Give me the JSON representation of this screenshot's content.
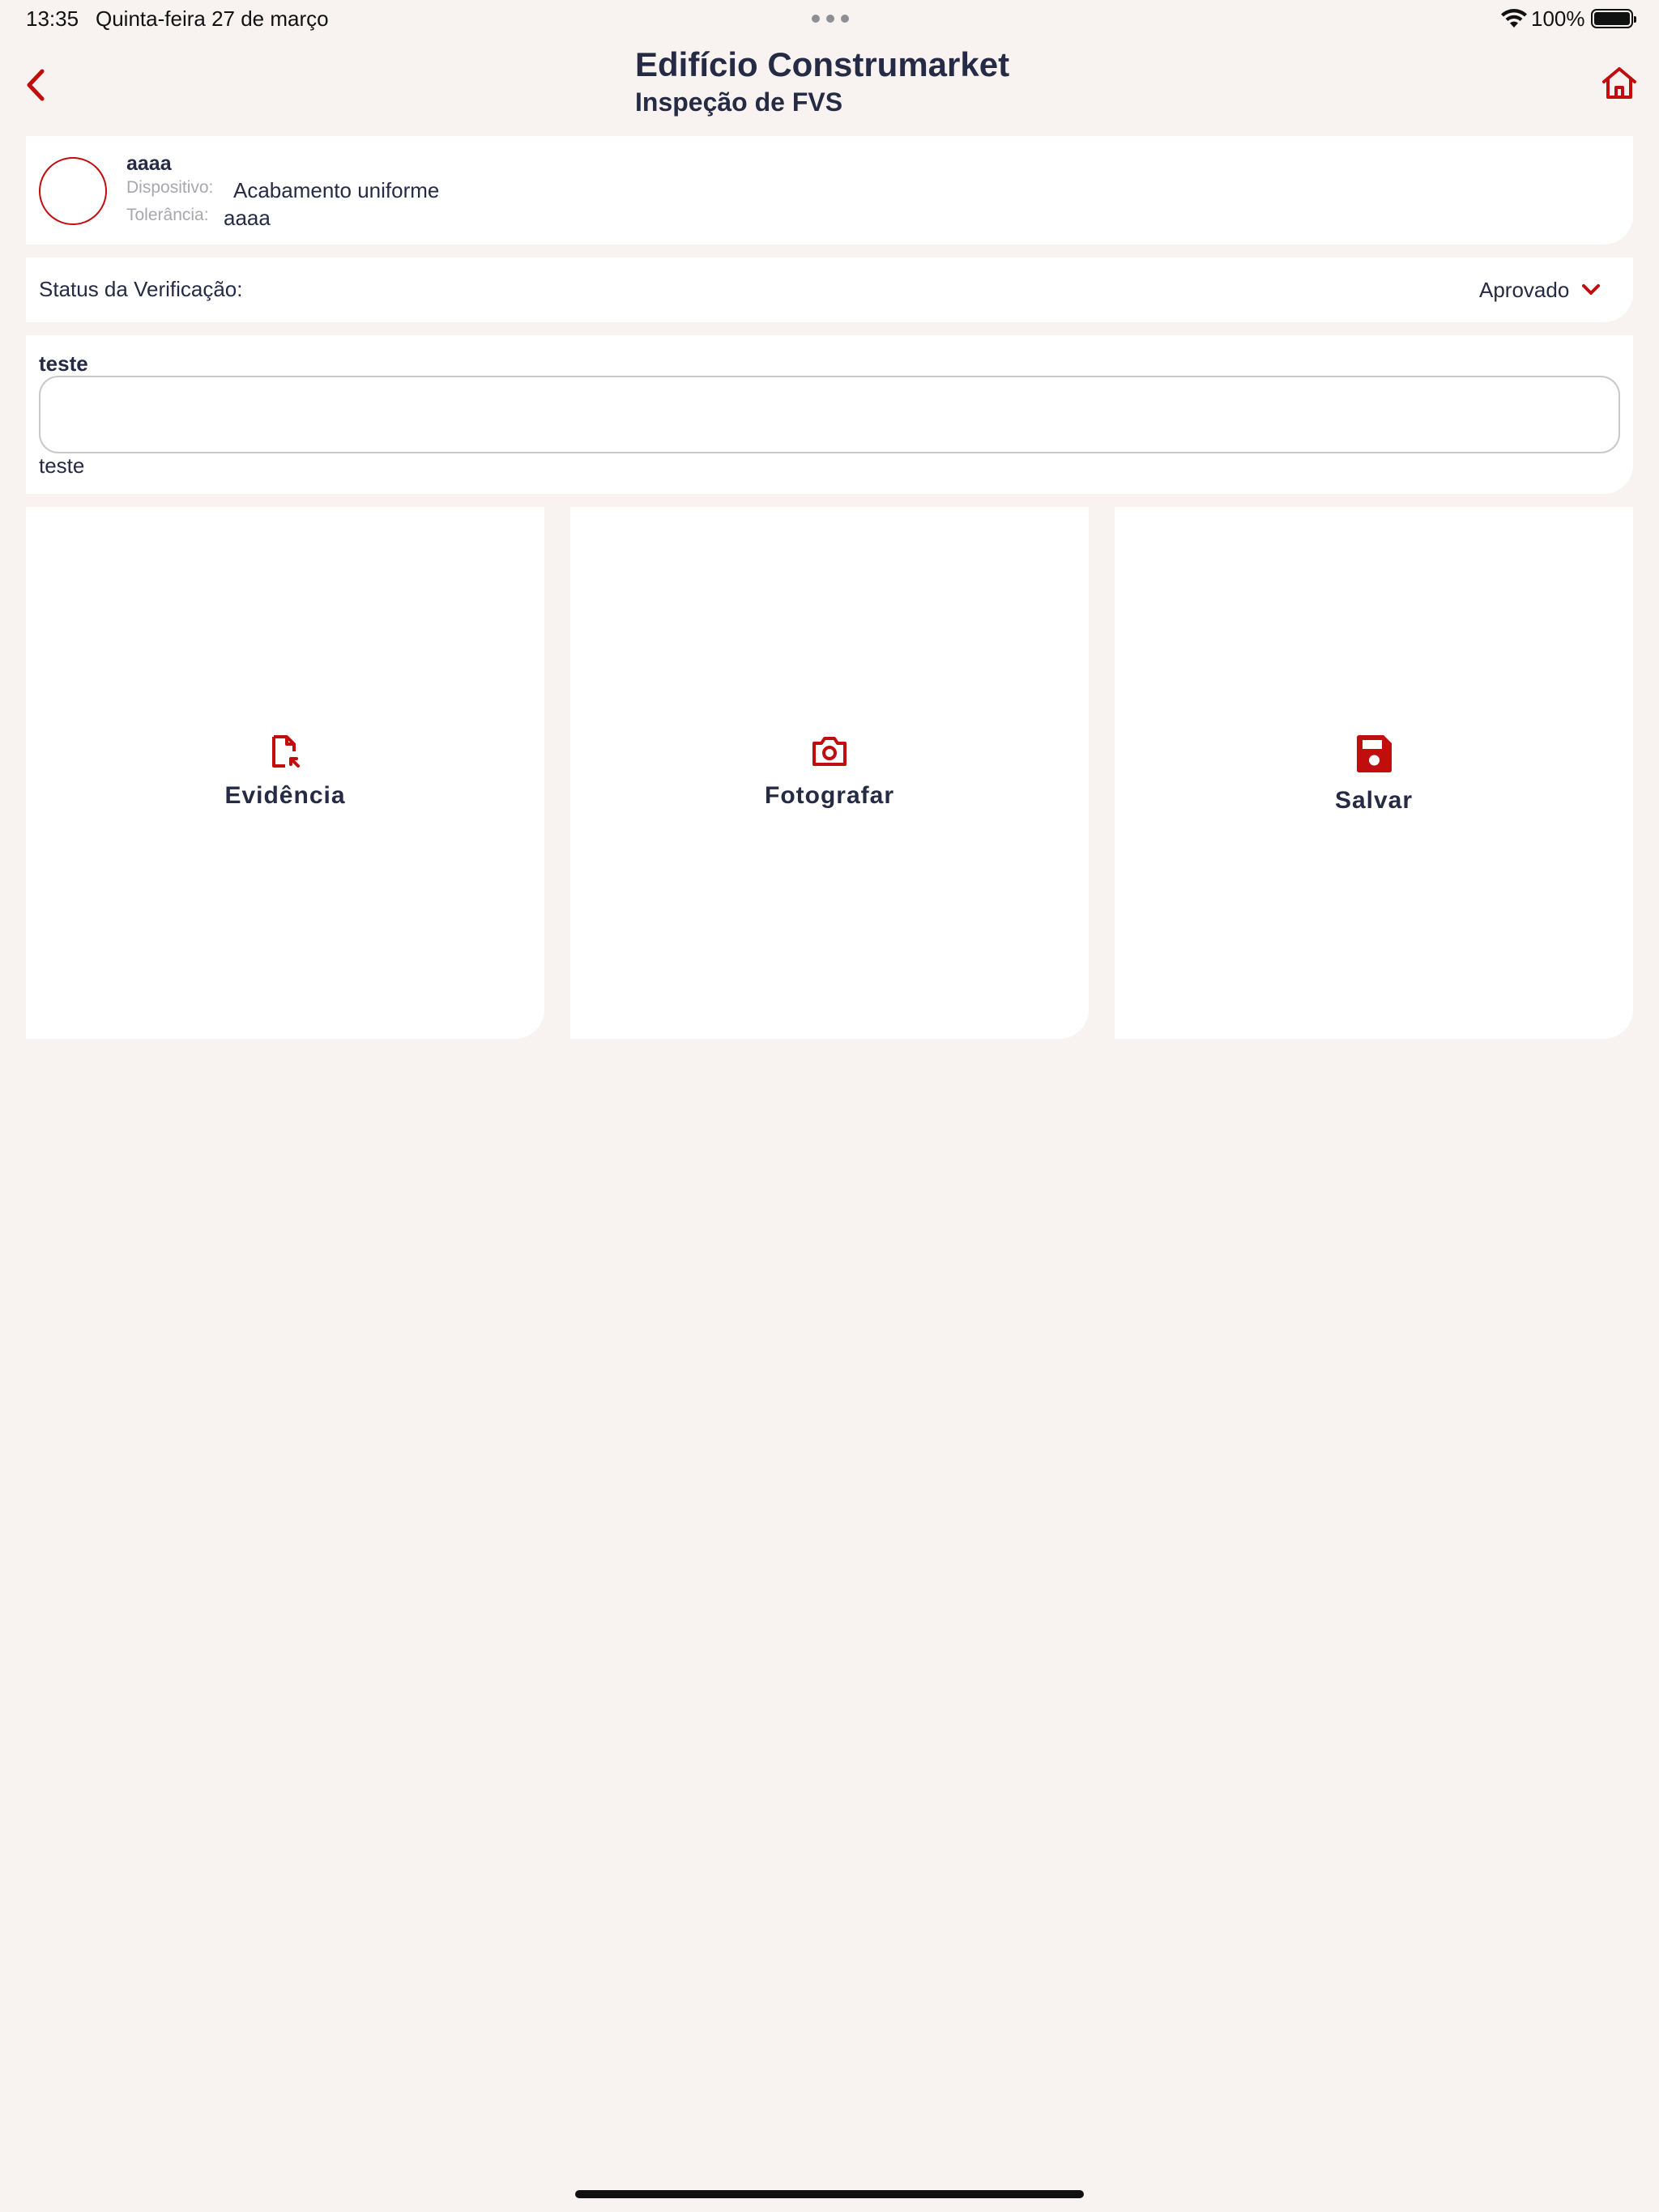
{
  "status_bar": {
    "time": "13:35",
    "date": "Quinta-feira 27 de março",
    "battery": "100%",
    "wifi_icon": "wifi-icon",
    "battery_icon": "battery-icon"
  },
  "header": {
    "title": "Edifício Construmarket",
    "subtitle": "Inspeção de FVS",
    "back_icon": "chevron-left-icon",
    "home_icon": "home-icon"
  },
  "item": {
    "name": "aaaa",
    "device_label": "Dispositivo:",
    "device_value": "Acabamento uniforme",
    "tolerance_label": "Tolerância:",
    "tolerance_value": "aaaa"
  },
  "status": {
    "label": "Status da Verificação:",
    "value": "Aprovado",
    "icon": "chevron-down-icon"
  },
  "notes": {
    "label": "teste",
    "input_value": "",
    "text": "teste"
  },
  "actions": [
    {
      "label": "Evidência",
      "icon": "file-export-icon"
    },
    {
      "label": "Fotografar",
      "icon": "camera-icon"
    },
    {
      "label": "Salvar",
      "icon": "save-icon"
    }
  ],
  "colors": {
    "accent": "#c00d0d",
    "background": "#f8f3f1",
    "text": "#262b45",
    "card": "#ffffff"
  }
}
